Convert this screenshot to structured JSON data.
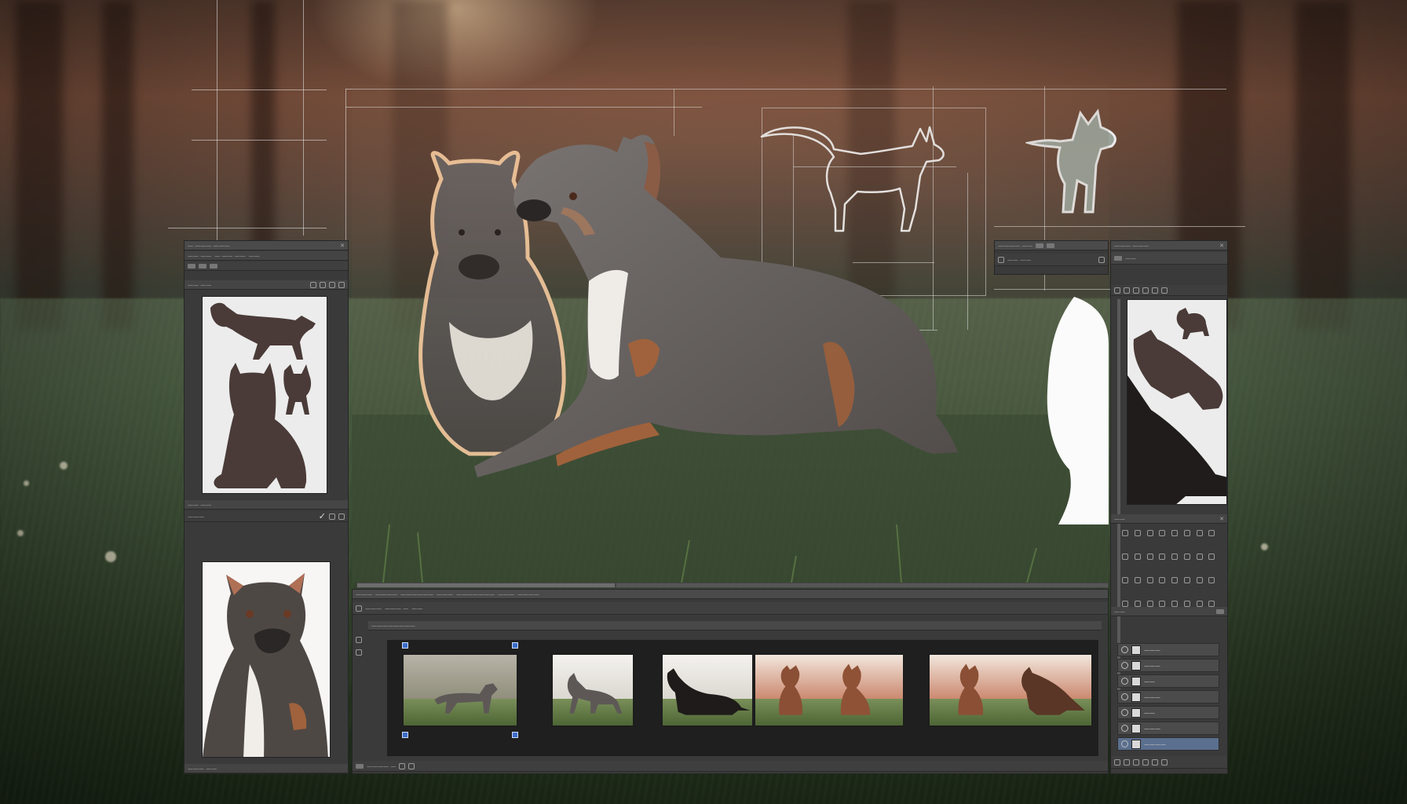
{
  "app": {
    "left_panel": {
      "header_label": "— ——— ———",
      "tabs": [
        "—— ——",
        "— —— ——",
        "——"
      ],
      "swatch_header_label": "—— ——",
      "props_label": "—— ——",
      "props_sub_label": "———",
      "bottom_status": "——— ——"
    },
    "options_bar": {
      "label_1": "———— ——",
      "label_2": "—— ——"
    },
    "timeline": {
      "menu": [
        "———",
        "————",
        "——————",
        "———",
        "———————",
        "———",
        "————"
      ],
      "sub_tabs": [
        "———",
        "——— —",
        "——"
      ],
      "panel_label": "————————",
      "footer_label": "———— —"
    },
    "right_panel": {
      "header_label": "——— ———",
      "section_label": "——",
      "tab_label": "——",
      "layers_label": "——",
      "layers": [
        {
          "name": "———",
          "selected": false
        },
        {
          "name": "———",
          "selected": false
        },
        {
          "name": "——",
          "selected": false
        },
        {
          "name": "———",
          "selected": false
        },
        {
          "name": "——",
          "selected": false
        },
        {
          "name": "———",
          "selected": false
        },
        {
          "name": "————",
          "selected": true
        }
      ]
    }
  },
  "icons": [
    "checkmark-icon",
    "pencil-icon",
    "eye-icon",
    "lock-icon",
    "trash-icon",
    "folder-icon",
    "brush-icon",
    "gear-icon"
  ],
  "colors": {
    "panel_bg": "#3a3a3a",
    "panel_bar": "#4a4a4a",
    "dog_grey": "#5d5856",
    "dog_tan": "#a0623c",
    "silhouette": "#4a3b38",
    "selection_blue": "#3b6cc9"
  }
}
